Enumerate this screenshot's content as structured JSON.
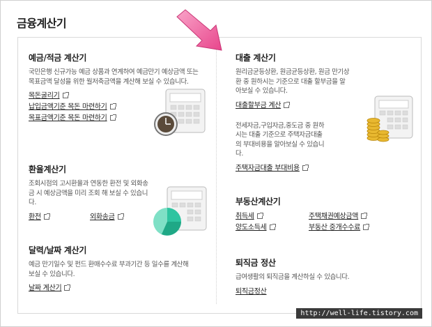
{
  "page_title": "금융계산기",
  "sections": {
    "savings": {
      "title": "예금/적금 계산기",
      "desc": "국민은행 신규가능 예금 상품과 연계하여 예금만기 예상금액 또는 목표금액 달성을 위한 월저축금액을 계산해 보실 수 있습니다.",
      "links": [
        "목돈굴리기",
        "납입금액기준 목돈 마련하기",
        "목표금액기준 목돈 마련하기"
      ]
    },
    "exchange": {
      "title": "환율계산기",
      "desc": "조회시점의 고시환율과 연동한 환전 및 외화송금 시 예상금액을 미리 조회 해 보실 수 있습니다.",
      "links": [
        "환전",
        "외화송금"
      ]
    },
    "calendar": {
      "title": "달력/날짜 계산기",
      "desc": "예금 만기일수 및 펀드 환매수수료 부과기간 등 일수를 계산해 보실 수 있습니다.",
      "links": [
        "날짜 계산기"
      ]
    },
    "loan": {
      "title": "대출 계산기",
      "desc1": "원리금균등상환, 원금균등상환, 원금 만기상환 중 원하시는 기준으로 대출 할부금을 알아보실 수 있습니다.",
      "link1": "대출할부금 계산",
      "desc2": "전세자금,구입자금,중도금 중 원하 시는 대출 기준으로 주택자금대출의 부대비용을 알아보실 수 있습니다.",
      "link2": "주택자금대출 부대비용"
    },
    "realestate": {
      "title": "부동산계산기",
      "links": [
        "취득세",
        "주택채권예상금액",
        "양도소득세",
        "부동산 중개수수료"
      ]
    },
    "severance": {
      "title": "퇴직금 정산",
      "desc": "급여생활의 퇴직금을 계산하실 수 있습니다.",
      "links": [
        "퇴직금정산"
      ]
    }
  },
  "watermark": "http://well-life.tistory.com",
  "colors": {
    "arrow": "#f06ea9",
    "chart": "#2ec4a0",
    "coin": "#d9a520"
  }
}
